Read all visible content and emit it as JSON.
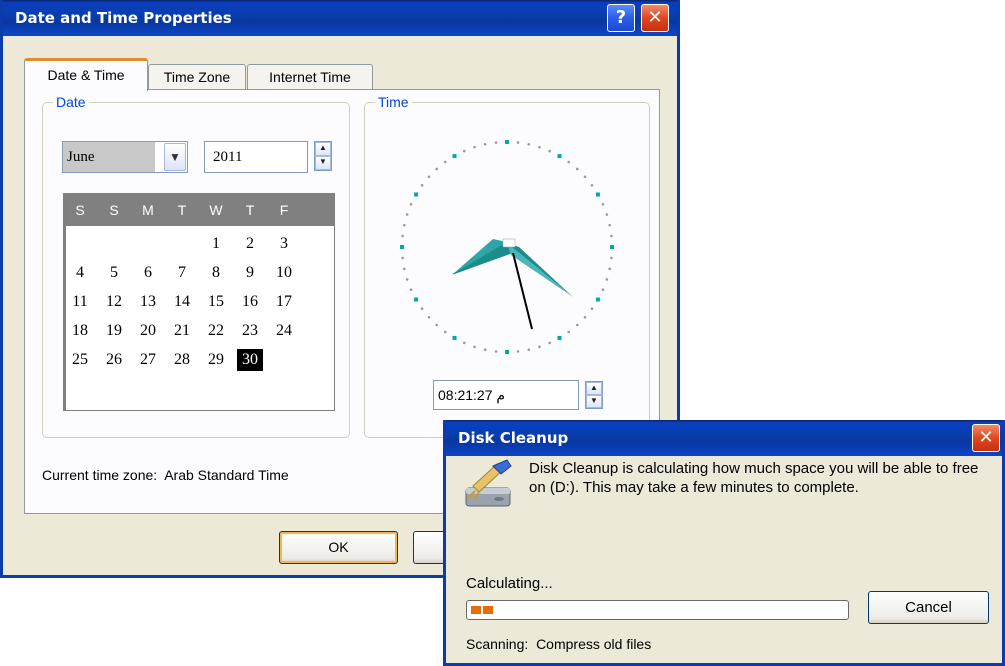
{
  "date_time": {
    "title": "Date and Time Properties",
    "help_glyph": "?",
    "close_glyph": "✕",
    "tabs": [
      {
        "label": "Date & Time",
        "active": true
      },
      {
        "label": "Time Zone",
        "active": false
      },
      {
        "label": "Internet Time",
        "active": false
      }
    ],
    "date_group": {
      "title": "Date",
      "month": "June",
      "year": "2011",
      "weekdays": [
        "S",
        "S",
        "M",
        "T",
        "W",
        "T",
        "F"
      ],
      "days": [
        "1",
        "2",
        "3",
        "4",
        "5",
        "6",
        "7",
        "8",
        "9",
        "10",
        "11",
        "12",
        "13",
        "14",
        "15",
        "16",
        "17",
        "18",
        "19",
        "20",
        "21",
        "22",
        "23",
        "24",
        "25",
        "26",
        "27",
        "28",
        "29",
        "30"
      ],
      "first_day_column": 4,
      "selected_day": "30"
    },
    "time_group": {
      "title": "Time",
      "time_value": "08:21:27 م"
    },
    "current_time_zone_label": "Current time zone:",
    "current_time_zone_value": "Arab Standard Time",
    "ok_label": "OK",
    "accent_color": "#0046d5",
    "clock_hand_color": "#1a8c8c"
  },
  "disk_cleanup": {
    "title": "Disk Cleanup",
    "close_glyph": "✕",
    "message": "Disk Cleanup is calculating how much space you will be able to free on  (D:). This may take a few minutes to complete.",
    "status": "Calculating...",
    "progress_fraction": 0.07,
    "progress_color": "#e46d0a",
    "cancel_label": "Cancel",
    "scanning_label": "Scanning:",
    "scanning_value": "Compress old files",
    "icon": "disk-cleanup-broom-icon"
  }
}
